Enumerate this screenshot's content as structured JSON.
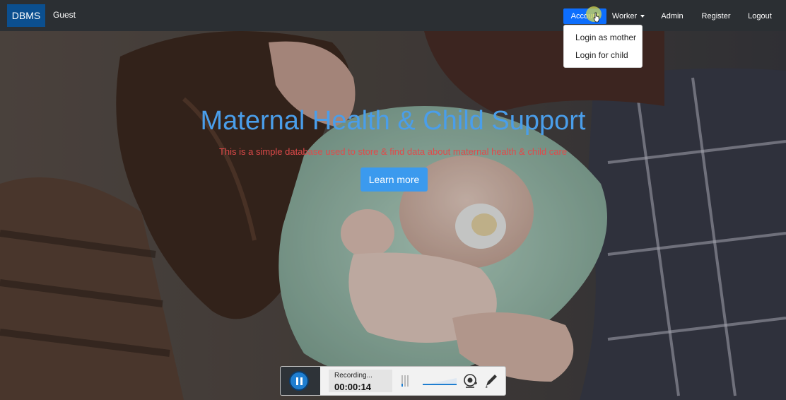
{
  "navbar": {
    "brand": "DBMS",
    "guest_label": "Guest",
    "items": [
      {
        "label": "Account",
        "active": true
      },
      {
        "label": "Worker"
      },
      {
        "label": "Admin"
      },
      {
        "label": "Register"
      },
      {
        "label": "Logout"
      }
    ]
  },
  "account_menu": {
    "items": [
      "Login as mother",
      "Login for child"
    ]
  },
  "hero": {
    "title": "Maternal Health & Child Support",
    "subtitle": "This is a simple database used to store & find data about maternal health & child care",
    "cta_label": "Learn more"
  },
  "recorder": {
    "status": "Recording...",
    "elapsed": "00:00:14"
  },
  "colors": {
    "navbar_bg": "#2b2f33",
    "brand_bg": "#0b4f8f",
    "active_nav": "#0d6efd",
    "title": "#4a9eea",
    "subtitle": "#e04a4a",
    "cta": "#3b9aee"
  }
}
